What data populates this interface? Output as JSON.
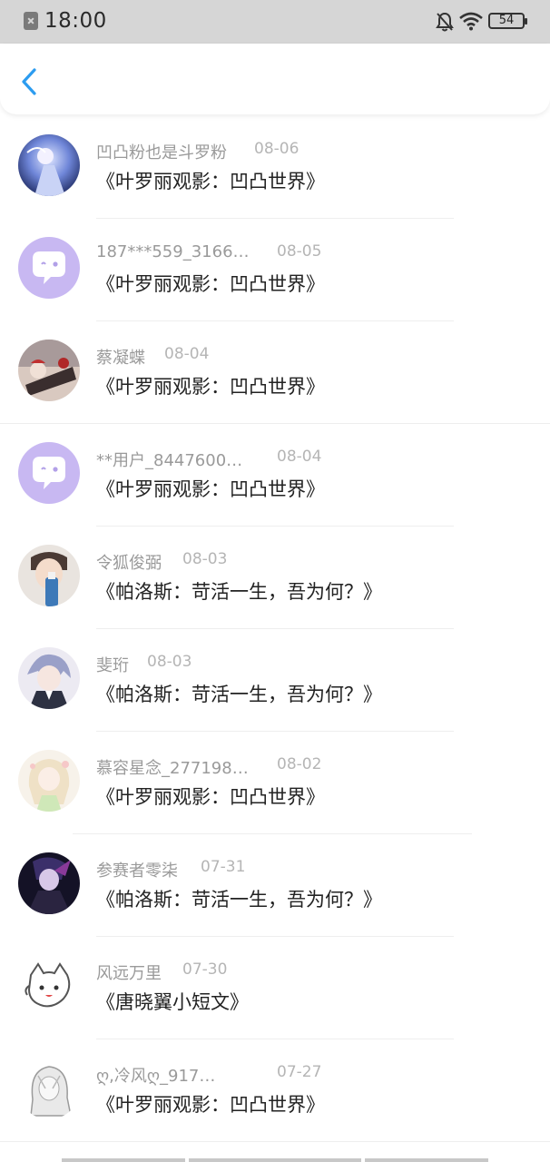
{
  "status_bar": {
    "time": "18:00",
    "battery": "54"
  },
  "items": [
    {
      "name": "凹凸粉也是斗罗粉",
      "date": "08-06",
      "title": "《叶罗丽观影：凹凸世界》"
    },
    {
      "name": "187***559_3166…",
      "date": "08-05",
      "title": "《叶罗丽观影：凹凸世界》"
    },
    {
      "name": "蔡凝蝶",
      "date": "08-04",
      "title": "《叶罗丽观影：凹凸世界》"
    },
    {
      "name": "**用户_8447600…",
      "date": "08-04",
      "title": "《叶罗丽观影：凹凸世界》"
    },
    {
      "name": "令狐俊弼",
      "date": "08-03",
      "title": "《帕洛斯：苛活一生，吾为何？》"
    },
    {
      "name": "斐珩",
      "date": "08-03",
      "title": "《帕洛斯：苛活一生，吾为何？》"
    },
    {
      "name": "慕容星念_277198…",
      "date": "08-02",
      "title": "《叶罗丽观影：凹凸世界》"
    },
    {
      "name": "参赛者零柒",
      "date": "07-31",
      "title": "《帕洛斯：苛活一生，吾为何？》"
    },
    {
      "name": "风远万里",
      "date": "07-30",
      "title": "《唐晓翼小短文》"
    },
    {
      "name": "ღ,冷风ღ_917…",
      "date": "07-27",
      "title": "《叶罗丽观影：凹凸世界》"
    }
  ],
  "colors": {
    "accent": "#2c9cf0",
    "bubble": "#c8b8f2"
  }
}
